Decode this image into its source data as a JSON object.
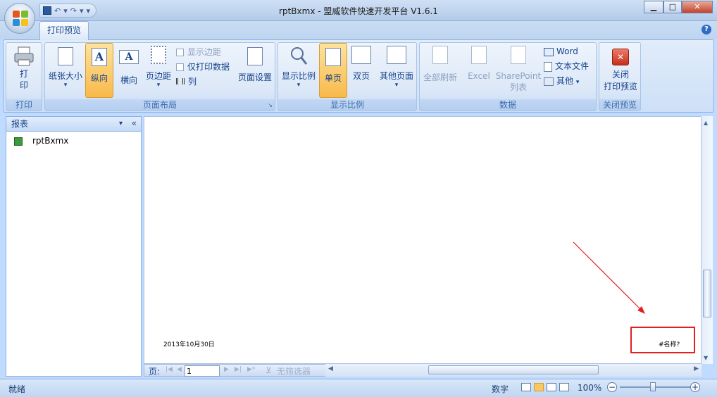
{
  "window": {
    "title": "rptBxmx - 盟威软件快速开发平台 V1.6.1",
    "min": "▁",
    "max": "□",
    "close": "✕"
  },
  "qat": {
    "save_icon": "save-icon",
    "undo": "↶",
    "redo": "↷",
    "more": "▾",
    "sep": "·"
  },
  "tabs": [
    {
      "label": "打印预览"
    }
  ],
  "help": "?",
  "groups": {
    "print": {
      "label": "打印",
      "print_btn": "打\n印"
    },
    "layout": {
      "label": "页面布局",
      "paper": "纸张大小",
      "portrait": "纵向",
      "landscape": "横向",
      "margins": "页边距",
      "show_margins": "显示边距",
      "print_data_only": "仅打印数据",
      "columns": "列",
      "page_setup": "页面设置"
    },
    "zoom": {
      "label": "显示比例",
      "zoom": "显示比例",
      "one_page": "单页",
      "two_pages": "双页",
      "more_pages": "其他页面"
    },
    "data": {
      "label": "数据",
      "refresh_all": "全部刷新",
      "excel": "Excel",
      "sharepoint": "SharePoint",
      "sharepoint2": "列表",
      "word": "Word",
      "text_file": "文本文件",
      "more": "其他"
    },
    "close": {
      "label": "关闭预览",
      "close_btn": "关闭",
      "close_btn2": "打印预览"
    }
  },
  "panel": {
    "header": "报表",
    "items": [
      {
        "label": "rptBxmx"
      }
    ]
  },
  "report": {
    "date": "2013年10月30日",
    "name_error": "#名称?"
  },
  "nav": {
    "page_label": "页:",
    "page_value": "1",
    "filter": "无筛选器"
  },
  "status": {
    "ready": "就绪",
    "mode": "数字",
    "zoom": "100%",
    "minus": "−",
    "plus": "+"
  },
  "colors": {
    "accent_red": "#e32020",
    "ribbon_active": "#f9b94b",
    "brand_blue": "#15428b"
  }
}
